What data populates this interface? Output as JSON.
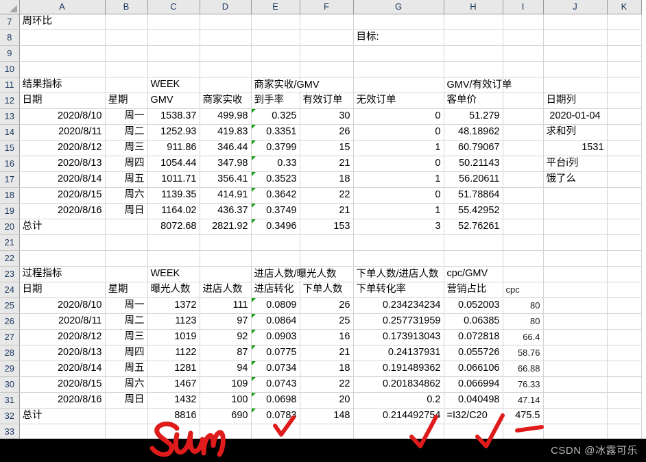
{
  "app": {
    "type": "spreadsheet",
    "watermark": "CSDN @冰露可乐"
  },
  "grid": {
    "columns": [
      "A",
      "B",
      "C",
      "D",
      "E",
      "F",
      "G",
      "H",
      "I",
      "J",
      "K"
    ],
    "rows": [
      "7",
      "8",
      "9",
      "10",
      "11",
      "12",
      "13",
      "14",
      "15",
      "16",
      "17",
      "18",
      "19",
      "20",
      "21",
      "22",
      "23",
      "24",
      "25",
      "26",
      "27",
      "28",
      "29",
      "30",
      "31",
      "32",
      "33"
    ]
  },
  "cells": {
    "r7": {
      "A": "周环比"
    },
    "r8": {
      "G": "目标:"
    },
    "r11": {
      "A": "结果指标",
      "C": "WEEK",
      "E": "商家实收/GMV",
      "H": "GMV/有效订单"
    },
    "r12": {
      "A": "日期",
      "B": "星期",
      "C": "GMV",
      "D": "商家实收",
      "E": "到手率",
      "F": "有效订单",
      "G": "无效订单",
      "H": "客单价",
      "J": "日期列"
    },
    "r13": {
      "A": "2020/8/10",
      "B": "周一",
      "C": "1538.37",
      "D": "499.98",
      "E": "0.325",
      "F": "30",
      "G": "0",
      "H": "51.279",
      "J": "2020-01-04"
    },
    "r14": {
      "A": "2020/8/11",
      "B": "周二",
      "C": "1252.93",
      "D": "419.83",
      "E": "0.3351",
      "F": "26",
      "G": "0",
      "H": "48.18962",
      "J": "求和列"
    },
    "r15": {
      "A": "2020/8/12",
      "B": "周三",
      "C": "911.86",
      "D": "346.44",
      "E": "0.3799",
      "F": "15",
      "G": "1",
      "H": "60.79067",
      "J": "1531"
    },
    "r16": {
      "A": "2020/8/13",
      "B": "周四",
      "C": "1054.44",
      "D": "347.98",
      "E": "0.33",
      "F": "21",
      "G": "0",
      "H": "50.21143",
      "J": "平台i列"
    },
    "r17": {
      "A": "2020/8/14",
      "B": "周五",
      "C": "1011.71",
      "D": "356.41",
      "E": "0.3523",
      "F": "18",
      "G": "1",
      "H": "56.20611",
      "J": "饿了么"
    },
    "r18": {
      "A": "2020/8/15",
      "B": "周六",
      "C": "1139.35",
      "D": "414.91",
      "E": "0.3642",
      "F": "22",
      "G": "0",
      "H": "51.78864"
    },
    "r19": {
      "A": "2020/8/16",
      "B": "周日",
      "C": "1164.02",
      "D": "436.37",
      "E": "0.3749",
      "F": "21",
      "G": "1",
      "H": "55.42952"
    },
    "r20": {
      "A": "总计",
      "C": "8072.68",
      "D": "2821.92",
      "E": "0.3496",
      "F": "153",
      "G": "3",
      "H": "52.76261"
    },
    "r23": {
      "A": "过程指标",
      "C": "WEEK",
      "E": "进店人数/曝光人数",
      "G": "下单人数/进店人数",
      "H": "cpc/GMV"
    },
    "r24": {
      "A": "日期",
      "B": "星期",
      "C": "曝光人数",
      "D": "进店人数",
      "E": "进店转化",
      "F": "下单人数",
      "G": "下单转化率",
      "H": "营销占比",
      "I": "cpc"
    },
    "r25": {
      "A": "2020/8/10",
      "B": "周一",
      "C": "1372",
      "D": "111",
      "E": "0.0809",
      "F": "26",
      "G": "0.234234234",
      "H": "0.052003",
      "I": "80"
    },
    "r26": {
      "A": "2020/8/11",
      "B": "周二",
      "C": "1123",
      "D": "97",
      "E": "0.0864",
      "F": "25",
      "G": "0.257731959",
      "H": "0.06385",
      "I": "80"
    },
    "r27": {
      "A": "2020/8/12",
      "B": "周三",
      "C": "1019",
      "D": "92",
      "E": "0.0903",
      "F": "16",
      "G": "0.173913043",
      "H": "0.072818",
      "I": "66.4"
    },
    "r28": {
      "A": "2020/8/13",
      "B": "周四",
      "C": "1122",
      "D": "87",
      "E": "0.0775",
      "F": "21",
      "G": "0.24137931",
      "H": "0.055726",
      "I": "58.76"
    },
    "r29": {
      "A": "2020/8/14",
      "B": "周五",
      "C": "1281",
      "D": "94",
      "E": "0.0734",
      "F": "18",
      "G": "0.191489362",
      "H": "0.066106",
      "I": "66.88"
    },
    "r30": {
      "A": "2020/8/15",
      "B": "周六",
      "C": "1467",
      "D": "109",
      "E": "0.0743",
      "F": "22",
      "G": "0.201834862",
      "H": "0.066994",
      "I": "76.33"
    },
    "r31": {
      "A": "2020/8/16",
      "B": "周日",
      "C": "1432",
      "D": "100",
      "E": "0.0698",
      "F": "20",
      "G": "0.2",
      "H": "0.040498",
      "I": "47.14"
    },
    "r32": {
      "A": "总计",
      "C": "8816",
      "D": "690",
      "E": "0.0783",
      "F": "148",
      "G": "0.214492754",
      "H": "=I32/C20",
      "I": "475.5"
    }
  },
  "annotations": {
    "sum_label": "Sum",
    "color": "#e01b1b",
    "marks": [
      "check-under-E32",
      "check-under-G32",
      "check-under-H32",
      "dash-under-I32",
      "handwritten-sum"
    ]
  }
}
